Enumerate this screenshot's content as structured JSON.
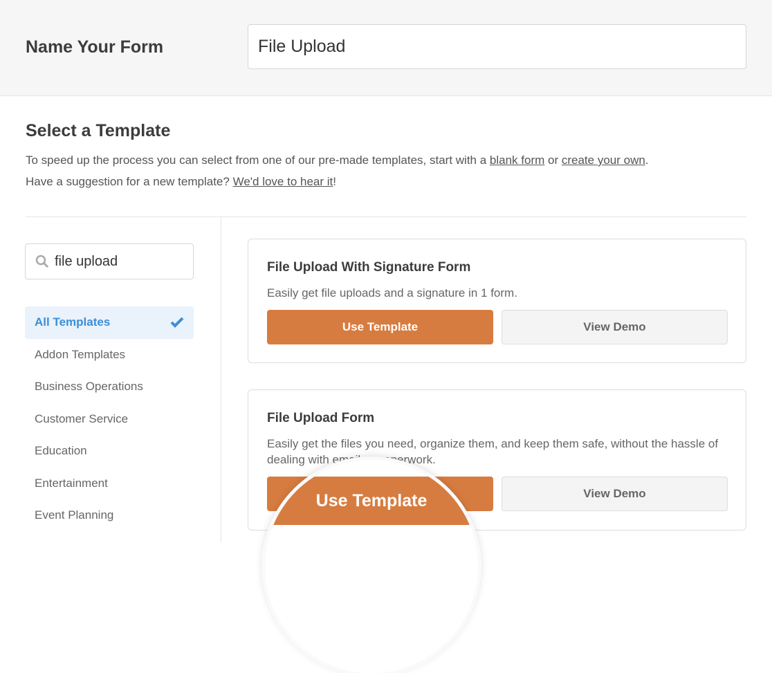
{
  "header": {
    "title": "Name Your Form",
    "form_name": "File Upload"
  },
  "intro": {
    "title": "Select a Template",
    "line1_pre": "To speed up the process you can select from one of our pre-made templates, start with a ",
    "blank_link": "blank form",
    "or": " or ",
    "own_link": "create your own",
    "period": ".",
    "line2_pre": "Have a suggestion for a new template? ",
    "suggest_link": "We'd love to hear it",
    "excl": "!"
  },
  "search": {
    "value": "file upload",
    "icon": "search-icon"
  },
  "categories": [
    {
      "label": "All Templates",
      "active": true
    },
    {
      "label": "Addon Templates"
    },
    {
      "label": "Business Operations"
    },
    {
      "label": "Customer Service"
    },
    {
      "label": "Education"
    },
    {
      "label": "Entertainment"
    },
    {
      "label": "Event Planning"
    }
  ],
  "templates": [
    {
      "title": "File Upload With Signature Form",
      "description": "Easily get file uploads and a signature in 1 form.",
      "use": "Use Template",
      "demo": "View Demo"
    },
    {
      "title": "File Upload Form",
      "description": "Easily get the files you need, organize them, and keep them safe, without the hassle of dealing with email or paperwork.",
      "use": "Use Template",
      "demo": "View Demo"
    }
  ],
  "magnifier": {
    "label": "Use Template"
  },
  "colors": {
    "accent": "#d77c40",
    "active": "#3b8edb"
  }
}
